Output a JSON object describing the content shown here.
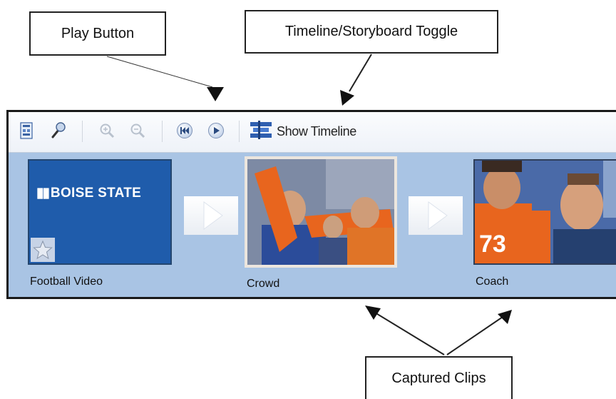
{
  "callouts": {
    "play": "Play Button",
    "toggle": "Timeline/Storyboard Toggle",
    "clips": "Captured Clips"
  },
  "toolbar": {
    "show_timeline_label": "Show Timeline",
    "icons": [
      "storyboard-icon",
      "narrate-icon",
      "zoom-in-icon",
      "zoom-out-icon",
      "rewind-icon",
      "play-icon",
      "timeline-icon"
    ]
  },
  "clips": [
    {
      "label": "Football Video",
      "thumbnail_text": "BOISE STATE"
    },
    {
      "label": "Crowd"
    },
    {
      "label": "Coach"
    }
  ],
  "colors": {
    "storyboard_bg": "#a9c4e4",
    "boise_blue": "#1f5cab",
    "boise_orange": "#e8651e"
  }
}
